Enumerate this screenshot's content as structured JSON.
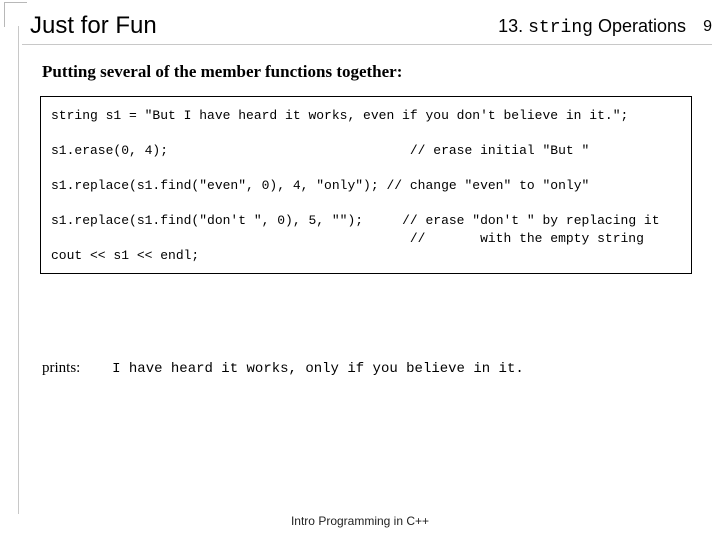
{
  "header": {
    "title": "Just for Fun",
    "chapter_num": "13.",
    "chapter_code": "string",
    "chapter_word": "Operations",
    "page": "9"
  },
  "subtitle": "Putting several of the member functions together:",
  "code": {
    "l1": "string s1 = \"But I have heard it works, even if you don't believe in it.\";",
    "l2a": "s1.erase(0, 4);",
    "l2b": "// erase initial \"But \"",
    "l3a": "s1.replace(s1.find(\"even\", 0), 4, \"only\");",
    "l3b": "// change \"even\" to \"only\"",
    "l4a": "s1.replace(s1.find(\"don't \", 0), 5, \"\");",
    "l4b": "// erase \"don't \" by replacing it",
    "l4c": "//       with the empty string",
    "l5": "cout << s1 << endl;"
  },
  "prints": {
    "label": "prints:",
    "output": "I have heard it works, only if you believe in it."
  },
  "footer": "Intro Programming in C++"
}
